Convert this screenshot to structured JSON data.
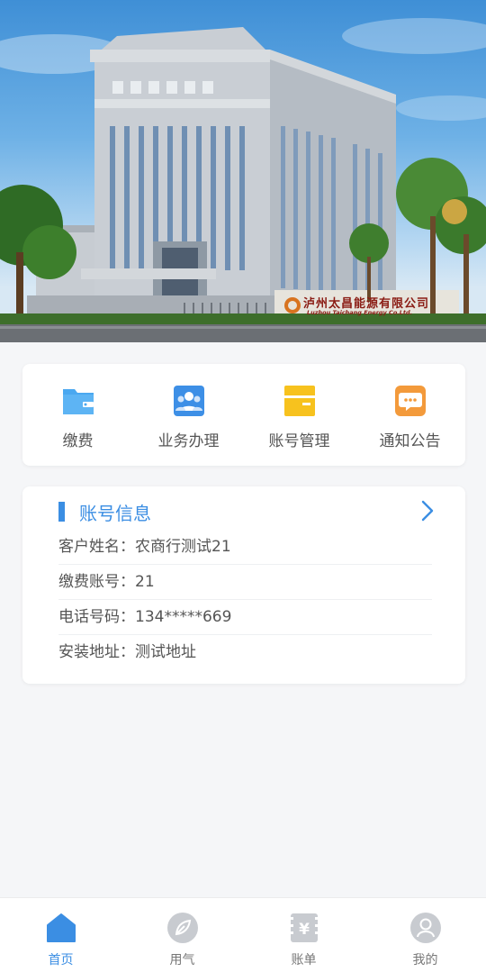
{
  "banner": {
    "sign_title": "泸州太昌能源有限公司",
    "sign_subtitle": "Luzhou Taichang Energy Co.Ltd."
  },
  "menu": [
    {
      "label": "缴费",
      "icon": "wallet-folder-icon",
      "color": "#4aa8f0"
    },
    {
      "label": "业务办理",
      "icon": "people-group-icon",
      "color": "#3d8fe6"
    },
    {
      "label": "账号管理",
      "icon": "account-card-icon",
      "color": "#f7c21e"
    },
    {
      "label": "通知公告",
      "icon": "message-bubble-icon",
      "color": "#f39a3b"
    }
  ],
  "account": {
    "title": "账号信息",
    "rows": [
      {
        "label": "客户姓名",
        "value": "农商行测试21",
        "text": "客户姓名：农商行测试21"
      },
      {
        "label": "缴费账号",
        "value": "21",
        "text": "缴费账号：21"
      },
      {
        "label": "电话号码",
        "value": "134*****669",
        "text": "电话号码：134*****669"
      },
      {
        "label": "安装地址",
        "value": "测试地址",
        "text": "安装地址：测试地址"
      }
    ],
    "accent": "#3b8ee3"
  },
  "tabs": [
    {
      "label": "首页",
      "icon": "home-icon",
      "active": true
    },
    {
      "label": "用气",
      "icon": "leaf-icon",
      "active": false
    },
    {
      "label": "账单",
      "icon": "bill-yen-icon",
      "active": false
    },
    {
      "label": "我的",
      "icon": "user-icon",
      "active": false
    }
  ]
}
